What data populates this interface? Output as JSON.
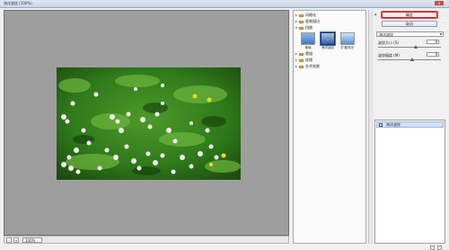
{
  "window": {
    "title": "海洋波纹 (100%)",
    "close_label": "x"
  },
  "statusbar": {
    "zoom_minus": "-",
    "zoom_plus": "+",
    "zoom_value": "100%"
  },
  "gallery": {
    "categories": [
      {
        "label": "风格化",
        "expanded": false
      },
      {
        "label": "画笔描边",
        "expanded": false
      },
      {
        "label": "扭曲",
        "expanded": true
      },
      {
        "label": "素描",
        "expanded": false
      },
      {
        "label": "纹理",
        "expanded": false
      },
      {
        "label": "艺术效果",
        "expanded": false
      }
    ],
    "thumbnails": [
      {
        "label": "玻璃",
        "selected": false
      },
      {
        "label": "海洋波纹",
        "selected": true
      },
      {
        "label": "扩散亮光",
        "selected": false
      }
    ]
  },
  "settings": {
    "ok_label": "确定",
    "cancel_label": "取消",
    "filter_select": "海洋波纹",
    "params": [
      {
        "label": "波纹大小 (S)",
        "value": "9"
      },
      {
        "label": "波纹幅度 (M)",
        "value": "9"
      }
    ]
  },
  "layers": {
    "row_label": "海洋波纹"
  },
  "colors": {
    "accent": "#2d6fd4",
    "highlight_red": "#d32020",
    "preview_bg": "#9e9e9e"
  }
}
